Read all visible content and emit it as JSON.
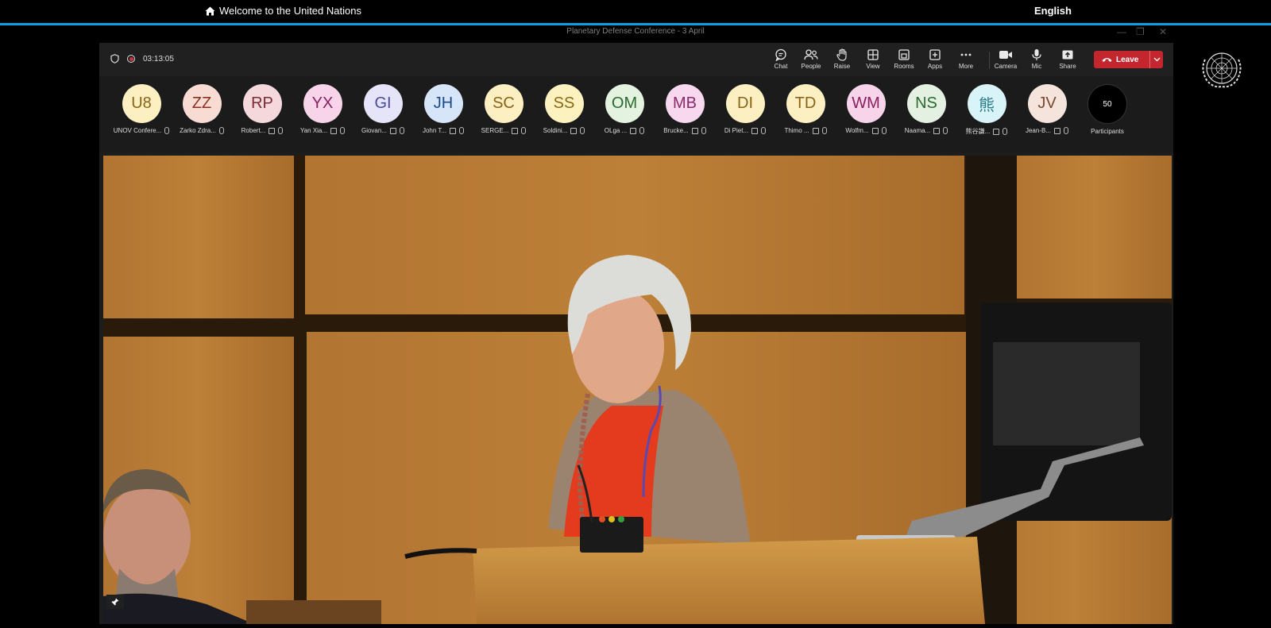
{
  "site": {
    "home_label": "Welcome to the United Nations",
    "language": "English"
  },
  "window": {
    "title": "Planetary Defense Conference - 3 April"
  },
  "meeting": {
    "timer": "03:13:05",
    "toolbar": [
      {
        "label": "Chat",
        "icon": "chat-icon"
      },
      {
        "label": "People",
        "icon": "people-icon"
      },
      {
        "label": "Raise",
        "icon": "hand-icon"
      },
      {
        "label": "View",
        "icon": "view-grid-icon"
      },
      {
        "label": "Rooms",
        "icon": "rooms-icon"
      },
      {
        "label": "Apps",
        "icon": "apps-icon"
      },
      {
        "label": "More",
        "icon": "more-icon"
      },
      {
        "label": "Camera",
        "icon": "camera-icon"
      },
      {
        "label": "Mic",
        "icon": "mic-icon"
      },
      {
        "label": "Share",
        "icon": "share-icon"
      }
    ],
    "leave_label": "Leave",
    "leave_color": "#c4262e",
    "participants": [
      {
        "initials": "U8",
        "name": "UNOV Confere...",
        "bg": "#fcefc2",
        "fg": "#8a6414"
      },
      {
        "initials": "ZZ",
        "name": "Zarko Zdra...",
        "bg": "#f8dcd4",
        "fg": "#8a3020"
      },
      {
        "initials": "RP",
        "name": "Robert...",
        "bg": "#f4d8dc",
        "fg": "#7a2a35"
      },
      {
        "initials": "YX",
        "name": "Yan Xia...",
        "bg": "#f8d4ea",
        "fg": "#8a2060"
      },
      {
        "initials": "GI",
        "name": "Giovan...",
        "bg": "#e6e4f8",
        "fg": "#4a4a9a"
      },
      {
        "initials": "JH",
        "name": "John T...",
        "bg": "#d6e6f8",
        "fg": "#1a4a8a"
      },
      {
        "initials": "SC",
        "name": "SERGE...",
        "bg": "#fcefc2",
        "fg": "#8a6414"
      },
      {
        "initials": "SS",
        "name": "Soldini...",
        "bg": "#fcf2c0",
        "fg": "#8a6a14"
      },
      {
        "initials": "OM",
        "name": "OLga ...",
        "bg": "#e4f2e0",
        "fg": "#2a6a30"
      },
      {
        "initials": "MB",
        "name": "Brucke...",
        "bg": "#f8d8ee",
        "fg": "#8a2a6a"
      },
      {
        "initials": "DI",
        "name": "Di Piet...",
        "bg": "#fcefc2",
        "fg": "#8a6414"
      },
      {
        "initials": "TD",
        "name": "Thimo ...",
        "bg": "#fcefc2",
        "fg": "#8a6414"
      },
      {
        "initials": "WM",
        "name": "Wolfm...",
        "bg": "#f8d4ea",
        "fg": "#8a2060"
      },
      {
        "initials": "NS",
        "name": "Naama...",
        "bg": "#e4f0e2",
        "fg": "#2a6a30"
      },
      {
        "initials": "熊",
        "name": "熊谷謙...",
        "bg": "#d8f4f8",
        "fg": "#2a7a8a"
      },
      {
        "initials": "JV",
        "name": "Jean-B...",
        "bg": "#f4e4dc",
        "fg": "#7a4a30"
      }
    ],
    "participants_count": "50",
    "participants_label": "Participants"
  },
  "colors": {
    "accent_line": "#0aa0e6",
    "recording": "#d13438"
  }
}
